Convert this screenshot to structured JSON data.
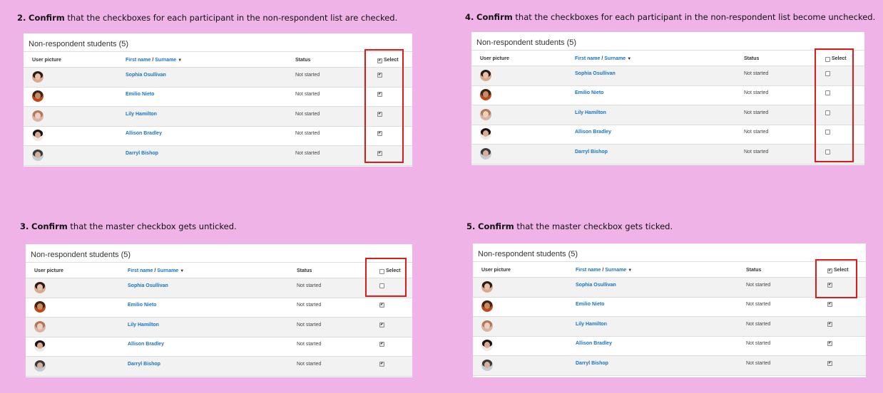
{
  "steps": [
    {
      "num": "2.",
      "bold": "Confirm",
      "text": " that the checkboxes for each participant in the non-respondent list are checked."
    },
    {
      "num": "4.",
      "bold": "Confirm",
      "text": " that the checkboxes for each participant in the non-respondent list become unchecked."
    },
    {
      "num": "3.",
      "bold": "Confirm",
      "text": " that the master checkbox gets unticked."
    },
    {
      "num": "5.",
      "bold": "Confirm",
      "text": " that the master checkbox gets ticked."
    }
  ],
  "panel_title": "Non-respondent students (5)",
  "columns": {
    "picture": "User picture",
    "firstname": "First name",
    "sep": " / ",
    "surname": "Surname",
    "status": "Status",
    "select": "Select"
  },
  "students": [
    {
      "name": "Sophia Osullivan",
      "status": "Not started"
    },
    {
      "name": "Emilio Nieto",
      "status": "Not started"
    },
    {
      "name": "Lily Hamilton",
      "status": "Not started"
    },
    {
      "name": "Allison Bradley",
      "status": "Not started"
    },
    {
      "name": "Darryl Bishop",
      "status": "Not started"
    }
  ],
  "panels_state": [
    {
      "master_checked": true,
      "rows_checked": [
        true,
        true,
        true,
        true,
        true
      ]
    },
    {
      "master_checked": false,
      "rows_checked": [
        false,
        false,
        false,
        false,
        false
      ]
    },
    {
      "master_checked": false,
      "rows_checked": [
        false,
        true,
        true,
        true,
        true
      ]
    },
    {
      "master_checked": true,
      "rows_checked": [
        true,
        true,
        true,
        true,
        true
      ]
    }
  ],
  "colors": {
    "background": "#efb3e8",
    "link": "#1a73c2",
    "highlight": "#e01919"
  }
}
